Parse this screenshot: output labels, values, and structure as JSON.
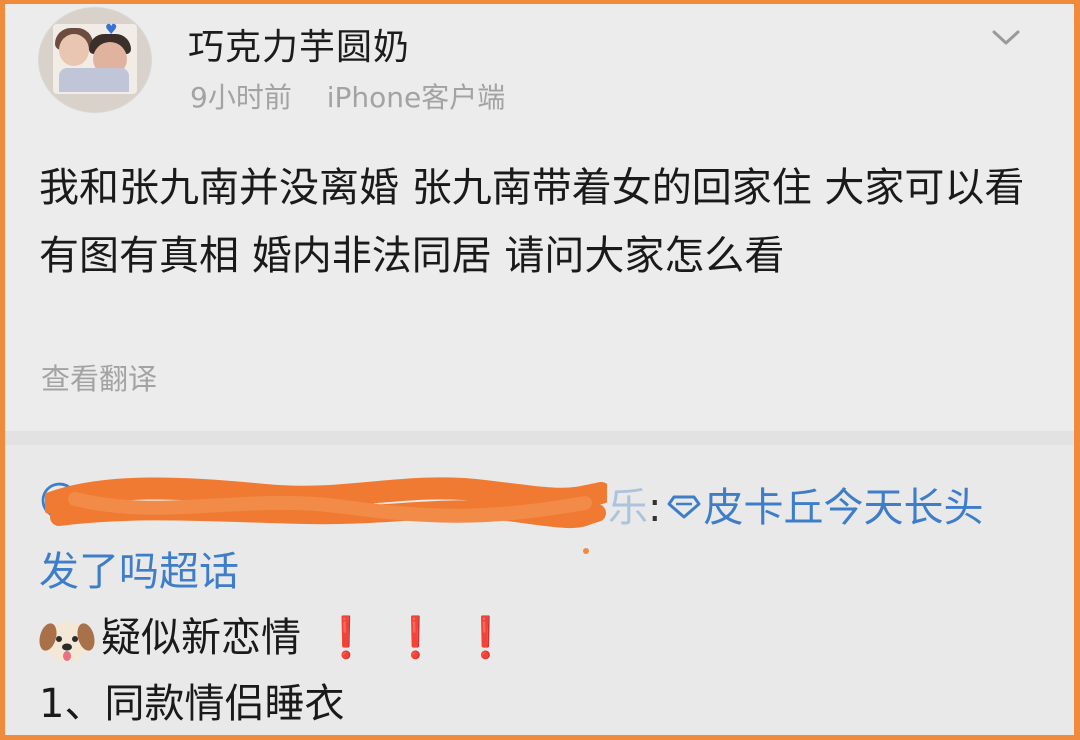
{
  "post": {
    "username": "巧克力芋圆奶",
    "time": "9小时前",
    "source": "iPhone客户端",
    "text": "我和张九南并没离婚  张九南带着女的回家住 大家可以看 有图有真相  婚内非法同居 请问大家怎么看",
    "translate_label": "查看翻译",
    "menu_icon": "chevron-down-icon"
  },
  "repost": {
    "mention_prefix": "@",
    "mention_name_visible_tail": "乐",
    "colon": ":",
    "supertopic_icon": "diamond-icon",
    "supertopic_first_line": "皮卡丘今天长头",
    "supertopic_second_line": "发了吗超话",
    "line3_text": "疑似新恋情",
    "line3_emoji": "dog-face-icon",
    "line3_marks": [
      "❗",
      "❗",
      "❗"
    ],
    "line4_text": "1、同款情侣睡衣"
  },
  "colors": {
    "border": "#f08a3c",
    "link": "#3e7ec9",
    "meta_gray": "#a3a3a3",
    "redaction": "#f07a32"
  }
}
